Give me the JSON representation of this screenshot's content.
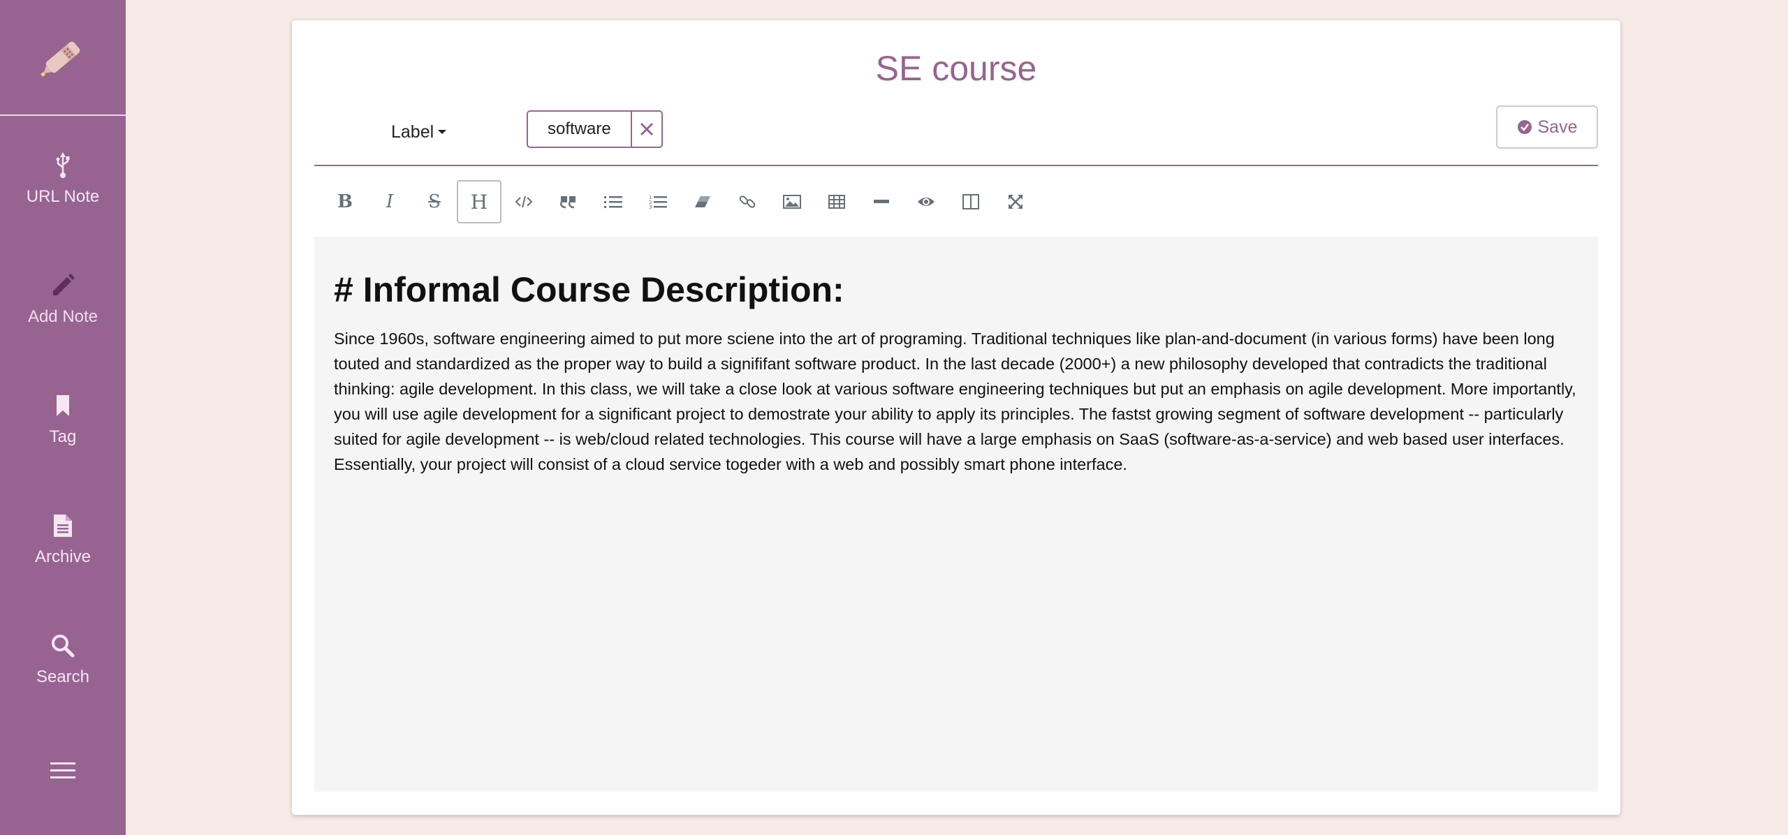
{
  "sidebar": {
    "logo_icon": "pen-nib-logo-icon",
    "items": [
      {
        "label": "URL Note",
        "icon": "usb-icon"
      },
      {
        "label": "Add Note",
        "icon": "pencil-icon"
      },
      {
        "label": "Tag",
        "icon": "bookmark-icon"
      },
      {
        "label": "Archive",
        "icon": "file-icon"
      },
      {
        "label": "Search",
        "icon": "search-icon"
      }
    ],
    "menu_icon": "hamburger-menu-icon"
  },
  "note": {
    "title": "SE course",
    "label_dropdown": "Label",
    "tag": "software",
    "save_label": "Save"
  },
  "editor": {
    "heading": "# Informal Course Description:",
    "body": "Since 1960s, software engineering aimed to put more sciene into the art of programing. Traditional techniques like plan-and-document (in various forms) have been long touted and standardized as the proper way to build a signififant software product. In the last decade (2000+) a new philosophy developed that contradicts the traditional thinking: agile development. In this class, we will take a close look at various software engineering techniques but put an emphasis on agile development. More importantly, you will use agile development for a significant project to demostrate your ability to apply its principles. The fastst growing segment of software development -- particularly suited for agile development -- is web/cloud related technologies. This course will have a large emphasis on SaaS (software-as-a-service) and web based user interfaces. Essentially, your project will consist of a cloud service togeder with a web and possibly smart phone interface."
  },
  "toolbar": [
    "bold",
    "italic",
    "strikethrough",
    "heading",
    "code",
    "quote",
    "unordered-list",
    "ordered-list",
    "clean-block",
    "link",
    "image",
    "table",
    "horizontal-rule",
    "preview",
    "side-by-side",
    "fullscreen"
  ],
  "colors": {
    "accent": "#976492",
    "background": "#f7ebe6",
    "editor_bg": "#f5f5f5"
  }
}
